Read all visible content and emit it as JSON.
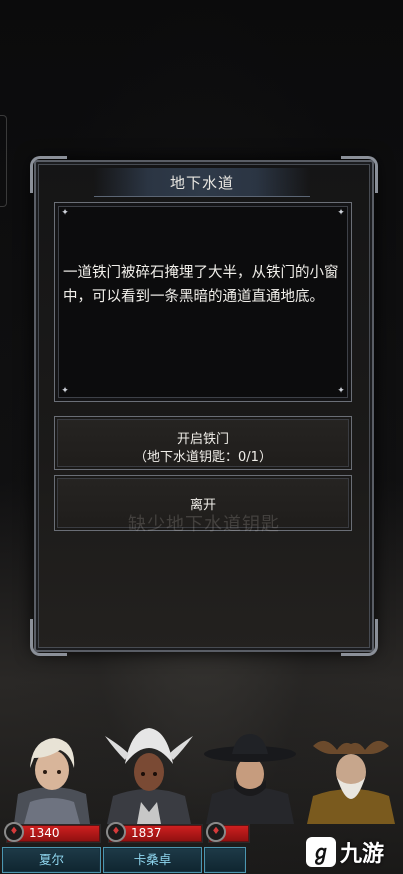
{
  "dialog": {
    "title": "地下水道",
    "body": "一道铁门被碎石掩埋了大半，从铁门的小窗中，可以看到一条黑暗的通道直通地底。",
    "options": [
      {
        "label": "开启铁门",
        "sublabel": "（地下水道钥匙：0/1）"
      },
      {
        "label": "离开"
      }
    ],
    "missing_hint": "缺少地下水道钥匙"
  },
  "party": [
    {
      "name": "夏尔",
      "hp": "1340",
      "icon": "blood-drop-icon"
    },
    {
      "name": "卡桑卓",
      "hp": "1837",
      "icon": "blood-drop-icon"
    },
    {
      "name": "",
      "hp": "",
      "icon": "blood-drop-icon"
    }
  ],
  "watermark": {
    "logo_glyph": "ℊ",
    "brand": "九游"
  },
  "colors": {
    "hp_red": "#c61a1a",
    "name_plate_border": "#4c96b0",
    "name_text": "#8fd6ef",
    "panel_border": "#6b6f77"
  }
}
